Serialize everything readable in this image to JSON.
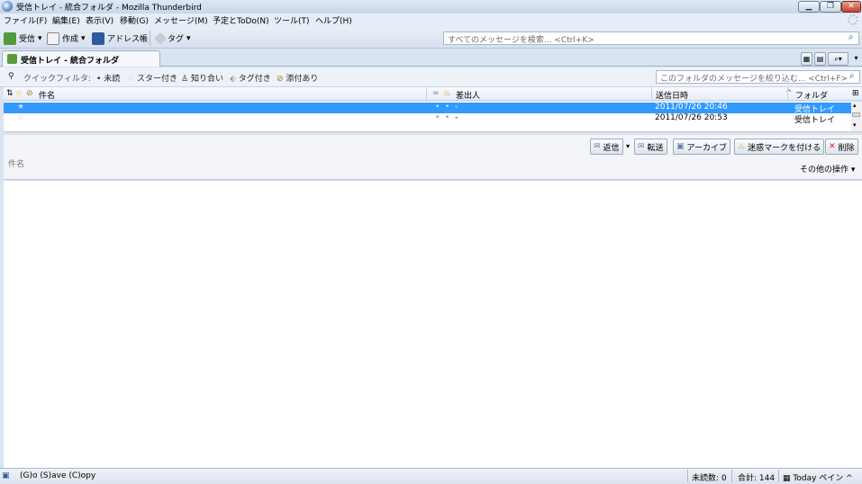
{
  "window": {
    "title": "受信トレイ - 統合フォルダ - Mozilla Thunderbird"
  },
  "menu": [
    "ファイル(F)",
    "編集(E)",
    "表示(V)",
    "移動(G)",
    "メッセージ(M)",
    "予定とToDo(N)",
    "ツール(T)",
    "ヘルプ(H)"
  ],
  "toolbar": {
    "get_mail": "受信",
    "write": "作成",
    "address_book": "アドレス帳",
    "tag": "タグ",
    "search_placeholder": "すべてのメッセージを検索... <Ctrl+K>"
  },
  "tab": {
    "label": "受信トレイ - 統合フォルダ"
  },
  "quick_filter": {
    "label": "クイックフィルタ:",
    "unread": "未読",
    "starred": "スター付き",
    "contact": "知り合い",
    "tags": "タグ付き",
    "attachment": "添付あり",
    "search_placeholder": "このフォルダのメッセージを絞り込む... <Ctrl+F>"
  },
  "columns": {
    "subject": "件名",
    "sender": "差出人",
    "date": "送信日時",
    "folder": "フォルダ"
  },
  "messages": [
    {
      "subject": "",
      "sender": "-",
      "date": "2011/07/26 20:46",
      "folder": "受信トレイ",
      "selected": true
    },
    {
      "subject": "",
      "sender": "-",
      "date": "2011/07/26 20:53",
      "folder": "受信トレイ",
      "selected": false
    }
  ],
  "header_buttons": {
    "reply": "返信",
    "forward": "転送",
    "archive": "アーカイブ",
    "junk": "迷惑マークを付ける",
    "delete": "削除"
  },
  "header": {
    "subject_label": "件名",
    "other_actions": "その他の操作"
  },
  "status": {
    "left": "(G)o (S)ave (C)opy",
    "unread": "未読数: 0",
    "total": "合計: 144",
    "today_pane": "Today ペイン"
  },
  "colors": {
    "selection": "#3399ff",
    "chrome": "#d9e4f1"
  }
}
